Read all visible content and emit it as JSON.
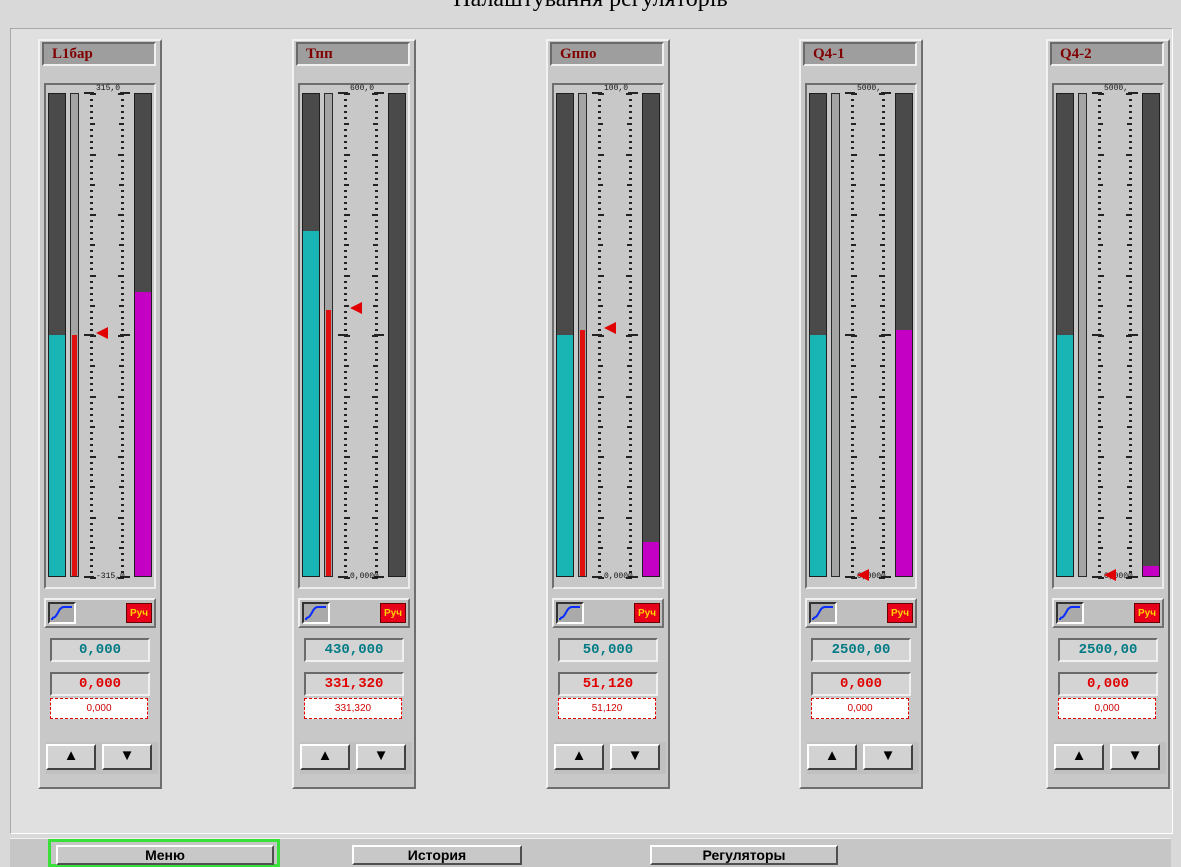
{
  "page": {
    "title": "Налаштування регуляторів"
  },
  "colors": {
    "pv": "#19b5b5",
    "out": "#c400c4",
    "sp": "#e01010",
    "marker": "#e00000"
  },
  "regulators": [
    {
      "name": "L1бар",
      "scale_top": "315,0",
      "scale_bottom": "-315,0",
      "setpoint": "0,000",
      "value": "0,000",
      "input": "0,000",
      "mode": "Руч",
      "pv_fraction": 0.5,
      "sp_fraction": 0.5,
      "out_fraction": 0.59,
      "marker_fraction": 0.5
    },
    {
      "name": "Тпп",
      "scale_top": "600,0",
      "scale_bottom": "0,0000",
      "setpoint": "430,000",
      "value": "331,320",
      "input": "331,320",
      "mode": "Руч",
      "pv_fraction": 0.716,
      "sp_fraction": 0.552,
      "out_fraction": 0.0,
      "marker_fraction": 0.552
    },
    {
      "name": "Gппо",
      "scale_top": "100,0",
      "scale_bottom": "0,0000",
      "setpoint": "50,000",
      "value": "51,120",
      "input": "51,120",
      "mode": "Руч",
      "pv_fraction": 0.5,
      "sp_fraction": 0.511,
      "out_fraction": 0.07,
      "marker_fraction": 0.511
    },
    {
      "name": "Q4-1",
      "scale_top": "5000,",
      "scale_bottom": "0,0000",
      "setpoint": "2500,00",
      "value": "0,000",
      "input": "0,000",
      "mode": "Руч",
      "pv_fraction": 0.5,
      "sp_fraction": 0.0,
      "out_fraction": 0.51,
      "marker_fraction": 0.0
    },
    {
      "name": "Q4-2",
      "scale_top": "5000,",
      "scale_bottom": "0,0000",
      "setpoint": "2500,00",
      "value": "0,000",
      "input": "0,000",
      "mode": "Руч",
      "pv_fraction": 0.5,
      "sp_fraction": 0.0,
      "out_fraction": 0.02,
      "marker_fraction": 0.0
    }
  ],
  "nav": {
    "menu": "Меню",
    "history": "История",
    "regulators": "Регуляторы"
  }
}
